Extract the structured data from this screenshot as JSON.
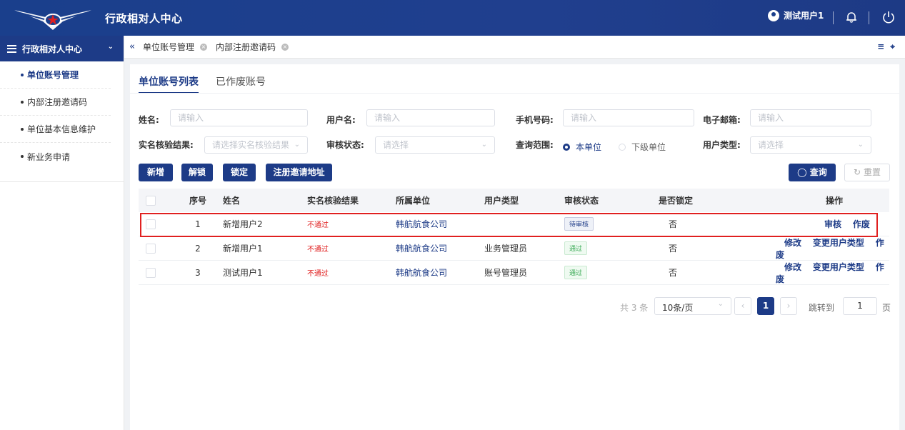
{
  "header": {
    "app_title": "行政相对人中心",
    "user_name": "测试用户1",
    "logo_name": "airline-wings-logo"
  },
  "sidebar": {
    "title": "行政相对人中心",
    "items": [
      {
        "label": "单位账号管理",
        "active": true
      },
      {
        "label": "内部注册邀请码",
        "active": false
      },
      {
        "label": "单位基本信息维护",
        "active": false
      },
      {
        "label": "新业务申请",
        "active": false
      }
    ]
  },
  "tabs": [
    {
      "label": "单位账号管理"
    },
    {
      "label": "内部注册邀请码"
    }
  ],
  "subtabs": {
    "list": "单位账号列表",
    "voided": "已作废账号"
  },
  "filters": {
    "name_label": "姓名:",
    "name_placeholder": "请输入",
    "username_label": "用户名:",
    "username_placeholder": "请输入",
    "phone_label": "手机号码:",
    "phone_placeholder": "请输入",
    "email_label": "电子邮箱:",
    "email_placeholder": "请输入",
    "realname_label": "实名核验结果:",
    "realname_placeholder": "请选择实名核验结果",
    "audit_label": "审核状态:",
    "audit_placeholder": "请选择",
    "scope_label": "查询范围:",
    "scope_this": "本单位",
    "scope_sub": "下级单位",
    "usertype_label": "用户类型:",
    "usertype_placeholder": "请选择"
  },
  "buttons": {
    "add": "新增",
    "unlock": "解锁",
    "lock": "锁定",
    "invite": "注册邀请地址",
    "search": "查询",
    "reset": "重置"
  },
  "table": {
    "headers": {
      "no": "序号",
      "name": "姓名",
      "realname": "实名核验结果",
      "unit": "所属单位",
      "usertype": "用户类型",
      "audit": "审核状态",
      "locked": "是否锁定",
      "ops": "操作"
    },
    "rows": [
      {
        "no": "1",
        "name": "新增用户2",
        "realname": "不通过",
        "unit": "韩航航食公司",
        "usertype": "",
        "audit": "待审核",
        "locked": "否",
        "ops": [
          "审核",
          "作废"
        ]
      },
      {
        "no": "2",
        "name": "新增用户1",
        "realname": "不通过",
        "unit": "韩航航食公司",
        "usertype": "业务管理员",
        "audit": "通过",
        "locked": "否",
        "ops": [
          "修改",
          "变更用户类型",
          "作废"
        ]
      },
      {
        "no": "3",
        "name": "测试用户1",
        "realname": "不通过",
        "unit": "韩航航食公司",
        "usertype": "账号管理员",
        "audit": "通过",
        "locked": "否",
        "ops": [
          "修改",
          "变更用户类型",
          "作废"
        ]
      }
    ]
  },
  "pagination": {
    "total": "共 3 条",
    "page_size": "10条/页",
    "current": "1",
    "jump_label": "跳转到",
    "jump_value": "1",
    "page_suffix": "页"
  },
  "colors": {
    "primary": "#1d3b87",
    "danger": "#e02020",
    "success": "#3aaa55"
  }
}
